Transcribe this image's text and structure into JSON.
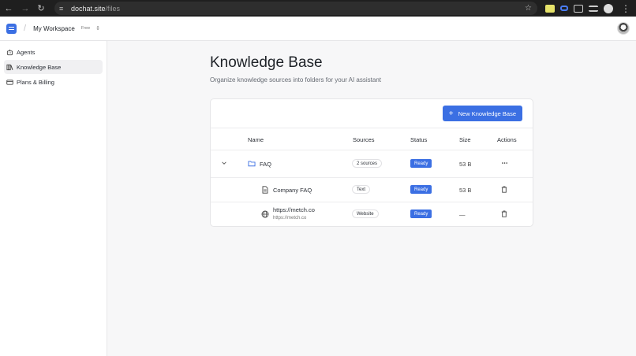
{
  "browser": {
    "url_host": "dochat.site",
    "url_path": "/files"
  },
  "topbar": {
    "workspace_name": "My Workspace",
    "plan_badge": "Free"
  },
  "sidebar": {
    "items": [
      {
        "label": "Agents",
        "icon": "bot-icon",
        "active": false
      },
      {
        "label": "Knowledge Base",
        "icon": "book-icon",
        "active": true
      },
      {
        "label": "Plans & Billing",
        "icon": "credit-card-icon",
        "active": false
      }
    ]
  },
  "main": {
    "title": "Knowledge Base",
    "subtitle": "Organize knowledge sources into folders for your AI assistant",
    "new_button_label": "New Knowledge Base",
    "table": {
      "headers": {
        "name": "Name",
        "sources": "Sources",
        "status": "Status",
        "size": "Size",
        "actions": "Actions"
      },
      "rows": [
        {
          "type": "folder",
          "name": "FAQ",
          "sources": "2 sources",
          "status": "Ready",
          "size": "53 B",
          "icon": "folder-icon",
          "action": "more-icon"
        },
        {
          "type": "file",
          "name": "Company FAQ",
          "sources": "Text",
          "status": "Ready",
          "size": "53 B",
          "icon": "document-icon",
          "action": "trash-icon"
        },
        {
          "type": "website",
          "name": "https://metch.co",
          "subtext": "https://metch.co",
          "sources": "Website",
          "status": "Ready",
          "size": "—",
          "icon": "globe-icon",
          "action": "trash-icon"
        }
      ]
    }
  },
  "colors": {
    "accent": "#3b6fe3",
    "background": "#f7f7f8"
  }
}
